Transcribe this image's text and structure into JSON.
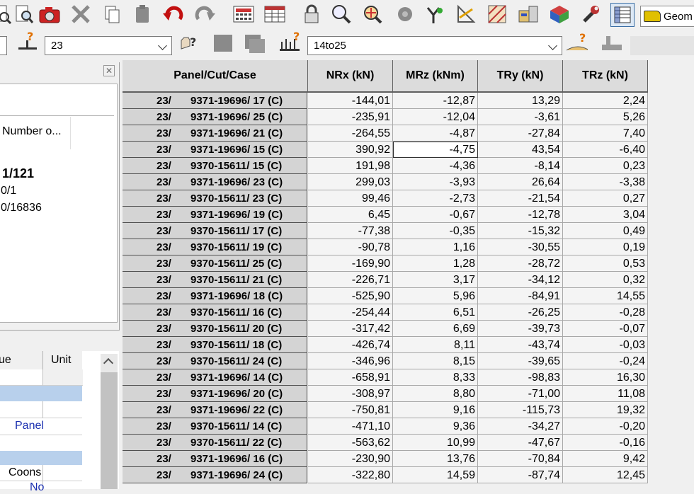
{
  "toolbar1": {
    "icons": [
      "open-document-icon",
      "camera-icon",
      "delete-icon",
      "copy-icon",
      "paste-icon",
      "undo-icon",
      "redo-icon",
      "calculator-icon",
      "spreadsheet-icon",
      "lock-icon",
      "zoom-icon",
      "zoom-extents-icon",
      "gear-grey-icon",
      "branch-icon",
      "measure-icon",
      "hatch-icon",
      "structure-icon",
      "3d-view-icon",
      "wrench-icon",
      "table-icon"
    ],
    "geom_label": "Geom"
  },
  "toolbar2": {
    "case_value": "23",
    "range_value": "14to25"
  },
  "left_panel": {
    "header": "Number o...",
    "value1": "1/121",
    "value2": "0/1",
    "value3": "0/16836"
  },
  "property_panel": {
    "col_value": "ue",
    "col_unit": "Unit",
    "row_panel": "Panel",
    "row_coons": "Coons",
    "row_no": "No"
  },
  "table": {
    "headers": [
      "Panel/Cut/Case",
      "NRx (kN)",
      "MRz (kNm)",
      "TRy (kN)",
      "TRz (kN)"
    ],
    "rows": [
      {
        "lc": "23/",
        "id": "9371-19696/ 17 (C)",
        "v": [
          "-144,01",
          "-12,87",
          "13,29",
          "2,24"
        ]
      },
      {
        "lc": "23/",
        "id": "9371-19696/ 25 (C)",
        "v": [
          "-235,91",
          "-12,04",
          "-3,61",
          "5,26"
        ]
      },
      {
        "lc": "23/",
        "id": "9371-19696/ 21 (C)",
        "v": [
          "-264,55",
          "-4,87",
          "-27,84",
          "7,40"
        ]
      },
      {
        "lc": "23/",
        "id": "9371-19696/ 15 (C)",
        "v": [
          "390,92",
          "-4,75",
          "43,54",
          "-6,40"
        ]
      },
      {
        "lc": "23/",
        "id": "9370-15611/ 15 (C)",
        "v": [
          "191,98",
          "-4,36",
          "-8,14",
          "0,23"
        ]
      },
      {
        "lc": "23/",
        "id": "9371-19696/ 23 (C)",
        "v": [
          "299,03",
          "-3,93",
          "26,64",
          "-3,38"
        ]
      },
      {
        "lc": "23/",
        "id": "9370-15611/ 23 (C)",
        "v": [
          "99,46",
          "-2,73",
          "-21,54",
          "0,27"
        ]
      },
      {
        "lc": "23/",
        "id": "9371-19696/ 19 (C)",
        "v": [
          "6,45",
          "-0,67",
          "-12,78",
          "3,04"
        ]
      },
      {
        "lc": "23/",
        "id": "9370-15611/ 17 (C)",
        "v": [
          "-77,38",
          "-0,35",
          "-15,32",
          "0,49"
        ]
      },
      {
        "lc": "23/",
        "id": "9370-15611/ 19 (C)",
        "v": [
          "-90,78",
          "1,16",
          "-30,55",
          "0,19"
        ]
      },
      {
        "lc": "23/",
        "id": "9370-15611/ 25 (C)",
        "v": [
          "-169,90",
          "1,28",
          "-28,72",
          "0,53"
        ]
      },
      {
        "lc": "23/",
        "id": "9370-15611/ 21 (C)",
        "v": [
          "-226,71",
          "3,17",
          "-34,12",
          "0,32"
        ]
      },
      {
        "lc": "23/",
        "id": "9371-19696/ 18 (C)",
        "v": [
          "-525,90",
          "5,96",
          "-84,91",
          "14,55"
        ]
      },
      {
        "lc": "23/",
        "id": "9370-15611/ 16 (C)",
        "v": [
          "-254,44",
          "6,51",
          "-26,25",
          "-0,28"
        ]
      },
      {
        "lc": "23/",
        "id": "9370-15611/ 20 (C)",
        "v": [
          "-317,42",
          "6,69",
          "-39,73",
          "-0,07"
        ]
      },
      {
        "lc": "23/",
        "id": "9370-15611/ 18 (C)",
        "v": [
          "-426,74",
          "8,11",
          "-43,74",
          "-0,03"
        ]
      },
      {
        "lc": "23/",
        "id": "9370-15611/ 24 (C)",
        "v": [
          "-346,96",
          "8,15",
          "-39,65",
          "-0,24"
        ]
      },
      {
        "lc": "23/",
        "id": "9371-19696/ 14 (C)",
        "v": [
          "-658,91",
          "8,33",
          "-98,83",
          "16,30"
        ]
      },
      {
        "lc": "23/",
        "id": "9371-19696/ 20 (C)",
        "v": [
          "-308,97",
          "8,80",
          "-71,00",
          "11,08"
        ]
      },
      {
        "lc": "23/",
        "id": "9371-19696/ 22 (C)",
        "v": [
          "-750,81",
          "9,16",
          "-115,73",
          "19,32"
        ]
      },
      {
        "lc": "23/",
        "id": "9370-15611/ 14 (C)",
        "v": [
          "-471,10",
          "9,36",
          "-34,27",
          "-0,20"
        ]
      },
      {
        "lc": "23/",
        "id": "9370-15611/ 22 (C)",
        "v": [
          "-563,62",
          "10,99",
          "-47,67",
          "-0,16"
        ]
      },
      {
        "lc": "23/",
        "id": "9371-19696/ 16 (C)",
        "v": [
          "-230,90",
          "13,76",
          "-70,84",
          "9,42"
        ]
      },
      {
        "lc": "23/",
        "id": "9371-19696/ 24 (C)",
        "v": [
          "-322,80",
          "14,59",
          "-87,74",
          "12,45"
        ]
      }
    ]
  }
}
